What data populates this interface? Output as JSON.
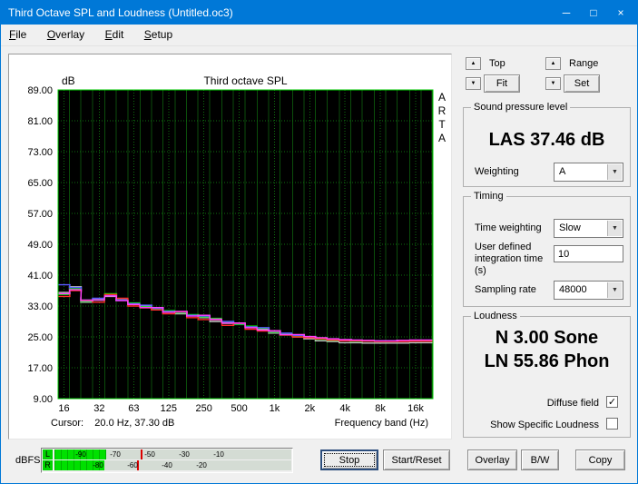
{
  "window": {
    "title": "Third Octave SPL and Loudness (Untitled.oc3)",
    "controls": {
      "minimize": "─",
      "maximize": "□",
      "close": "×"
    }
  },
  "icons": {
    "up": "▲",
    "down": "▼",
    "check": "✓"
  },
  "menu": {
    "items": [
      "File",
      "Overlay",
      "Edit",
      "Setup"
    ]
  },
  "chart_data": {
    "type": "bar",
    "title": "Third octave SPL",
    "ylabel": "dB",
    "xlabel": "Frequency band (Hz)",
    "watermark": "ARTA",
    "cursor_readout": "Cursor:    20.0 Hz, 37.30 dB",
    "ylim": [
      9,
      89
    ],
    "grid": true,
    "y_ticks": [
      "89.00",
      "81.00",
      "73.00",
      "65.00",
      "57.00",
      "49.00",
      "41.00",
      "33.00",
      "25.00",
      "17.00",
      "9.00"
    ],
    "x_ticks": [
      {
        "f": 16,
        "label": "16"
      },
      {
        "f": 32,
        "label": "32"
      },
      {
        "f": 63,
        "label": "63"
      },
      {
        "f": 125,
        "label": "125"
      },
      {
        "f": 250,
        "label": "250"
      },
      {
        "f": 500,
        "label": "500"
      },
      {
        "f": 1000,
        "label": "1k"
      },
      {
        "f": 2000,
        "label": "2k"
      },
      {
        "f": 4000,
        "label": "4k"
      },
      {
        "f": 8000,
        "label": "8k"
      },
      {
        "f": 16000,
        "label": "16k"
      }
    ],
    "bands": [
      16,
      20,
      25,
      31.5,
      40,
      50,
      63,
      80,
      100,
      125,
      160,
      200,
      250,
      315,
      400,
      500,
      630,
      800,
      1000,
      1250,
      1600,
      2000,
      2500,
      3150,
      4000,
      5000,
      6300,
      8000,
      10000,
      12500,
      16000,
      20000
    ],
    "series": [
      {
        "name": "Gray",
        "color": "#c8c8c8",
        "values": [
          36.5,
          38.0,
          34.0,
          34.5,
          35.5,
          34.5,
          33.5,
          33.0,
          32.5,
          31.5,
          31.0,
          30.5,
          30.0,
          29.0,
          28.5,
          28.5,
          27.5,
          27.0,
          26.0,
          25.5,
          25.0,
          24.5,
          24.0,
          23.8,
          23.5,
          23.5,
          23.4,
          23.4,
          23.4,
          23.4,
          23.5,
          23.5
        ]
      },
      {
        "name": "Green",
        "color": "#00e000",
        "values": [
          36.0,
          37.5,
          34.2,
          34.8,
          36.2,
          34.8,
          33.8,
          32.8,
          32.2,
          31.8,
          31.2,
          30.8,
          30.2,
          29.8,
          28.8,
          28.2,
          27.8,
          27.2,
          26.2,
          25.8,
          25.2,
          24.9,
          24.4,
          24.1,
          24.0,
          23.9,
          23.9,
          23.9,
          23.9,
          23.9,
          24.0,
          24.0
        ]
      },
      {
        "name": "Blue",
        "color": "#5858ff",
        "values": [
          38.5,
          37.8,
          34.6,
          35.0,
          35.8,
          34.6,
          33.6,
          33.2,
          32.4,
          31.6,
          31.4,
          30.6,
          30.4,
          29.4,
          29.0,
          28.4,
          27.6,
          27.4,
          26.4,
          26.0,
          25.4,
          25.0,
          24.6,
          24.3,
          24.1,
          24.0,
          24.0,
          24.0,
          24.0,
          24.0,
          24.1,
          24.1
        ]
      },
      {
        "name": "Red",
        "color": "#ff2a2a",
        "values": [
          35.5,
          37.0,
          34.5,
          34.0,
          36.0,
          35.0,
          33.0,
          32.5,
          32.0,
          31.0,
          31.5,
          30.0,
          29.5,
          29.5,
          28.0,
          28.5,
          27.0,
          26.5,
          26.5,
          25.5,
          25.0,
          24.8,
          24.5,
          24.2,
          24.0,
          24.0,
          23.9,
          23.8,
          23.8,
          23.8,
          23.9,
          23.9
        ]
      },
      {
        "name": "Magenta",
        "color": "#ff40ff",
        "values": [
          36.2,
          37.2,
          34.4,
          34.6,
          35.6,
          34.4,
          33.4,
          32.6,
          32.6,
          31.4,
          31.6,
          30.4,
          30.6,
          29.6,
          28.6,
          28.6,
          27.4,
          26.8,
          26.6,
          25.6,
          25.6,
          25.1,
          24.8,
          24.5,
          24.3,
          24.2,
          24.1,
          24.0,
          24.0,
          24.1,
          24.2,
          24.2
        ]
      }
    ],
    "colors": {
      "plot_bg": "#000000",
      "frame": "#00cc00",
      "grid_major": "#0e6e0e",
      "grid_minor": "#0b4d0b"
    }
  },
  "right_panel": {
    "top_controls": {
      "top_label": "Top",
      "fit_button": "Fit",
      "range_label": "Range",
      "set_button": "Set"
    },
    "spl_group": {
      "legend": "Sound pressure level",
      "value": "LAS 37.46 dB",
      "weighting_label": "Weighting",
      "weighting_value": "A"
    },
    "timing_group": {
      "legend": "Timing",
      "time_weighting_label": "Time weighting",
      "time_weighting_value": "Slow",
      "integration_label": "User defined integration time (s)",
      "integration_value": "10",
      "sampling_label": "Sampling rate",
      "sampling_value": "48000"
    },
    "loudness_group": {
      "legend": "Loudness",
      "n_value": "N 3.00 Sone",
      "ln_value": "LN 55.86 Phon",
      "diffuse_label": "Diffuse field",
      "diffuse_checked": true,
      "specific_label": "Show Specific Loudness",
      "specific_checked": false
    }
  },
  "bottom_bar": {
    "dbfs_label": "dBFS",
    "meter": {
      "rows": [
        {
          "channel": "L",
          "level_db": -75,
          "peak_db": -55,
          "scale_labels": [
            -90,
            -70,
            -50,
            -30,
            -10
          ]
        },
        {
          "channel": "R",
          "level_db": -76,
          "peak_db": -57,
          "scale_labels": [
            -80,
            -60,
            -40,
            -20
          ]
        }
      ]
    },
    "stop_button": "Stop",
    "start_reset_button": "Start/Reset",
    "overlay_button": "Overlay",
    "bw_button": "B/W",
    "copy_button": "Copy"
  }
}
